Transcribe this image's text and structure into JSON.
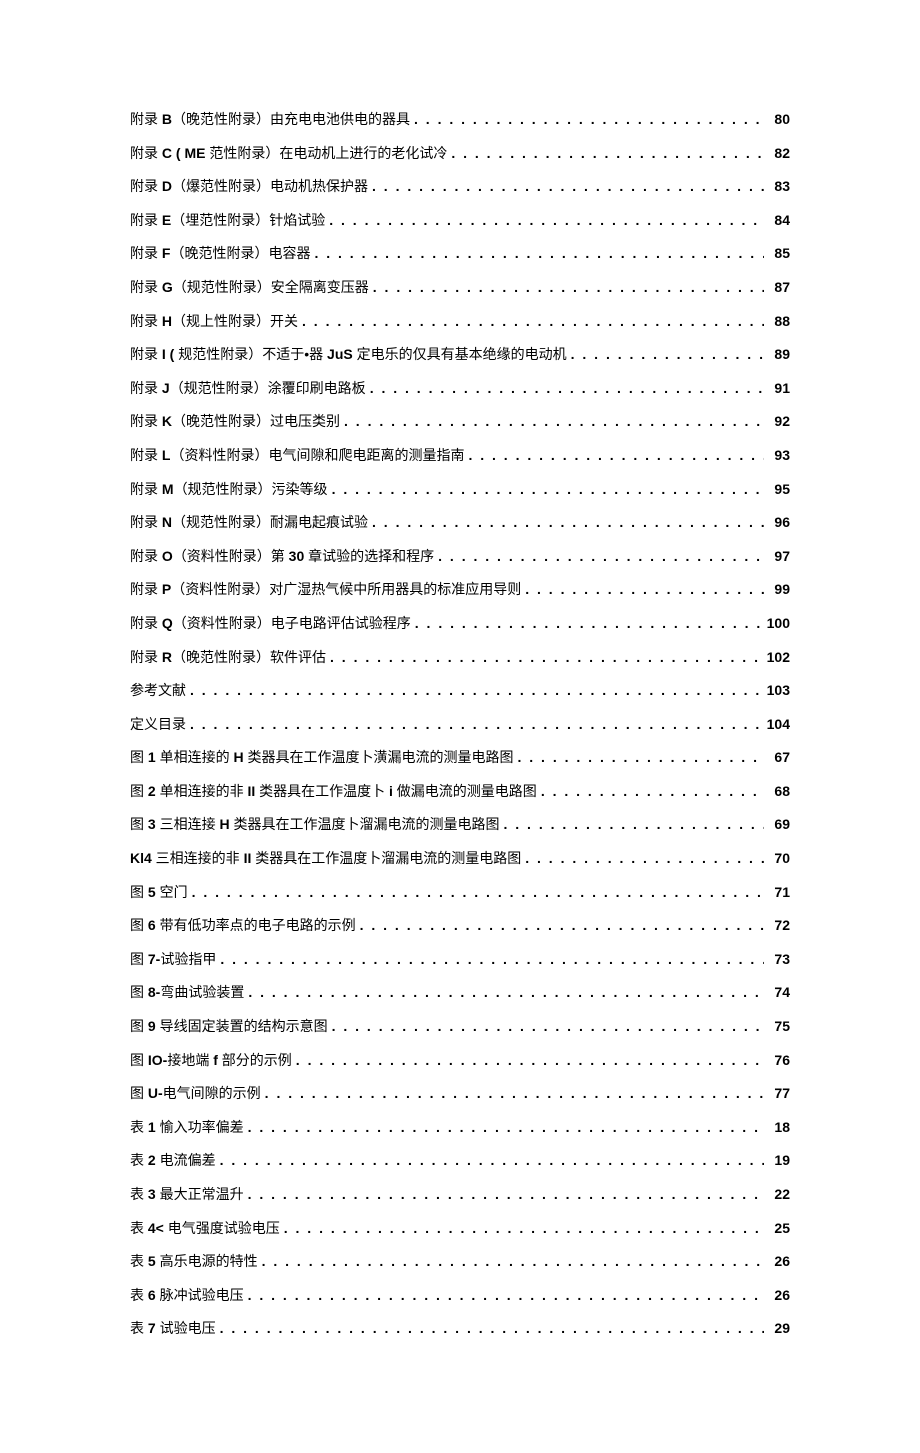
{
  "entries": [
    {
      "label": "附录 <b>B</b>（晚范性附录）由充电电池供电的器具",
      "page": "80"
    },
    {
      "label": "附录 <b>C ( ME</b> 范性附录）在电动机上进行的老化试冷",
      "page": "82"
    },
    {
      "label": "附录 <b>D</b>（爆范性附录）电动机热保护器",
      "page": "83"
    },
    {
      "label": "附录 <b>E</b>（埋范性附录）针焰试验",
      "page": "84"
    },
    {
      "label": "附录 <b>F</b>（晚范性附录）电容器",
      "page": "85"
    },
    {
      "label": "附录 <b>G</b>（规范性附录）安全隔离变压器",
      "page": "87"
    },
    {
      "label": "附录 <b>H</b>（规上性附录）开关",
      "page": "88"
    },
    {
      "label": "附录 <b>I (</b> 规范性附录）不适于•器 <b>JuS</b> 定电乐的仅具有基本绝缘的电动机",
      "page": "89"
    },
    {
      "label": "附录 <b>J</b>（规范性附录）涂覆印刷电路板",
      "page": "91"
    },
    {
      "label": "附录 <b>K</b>（晚范性附录）过电压类别",
      "page": "92"
    },
    {
      "label": "附录 <b>L</b>（资料性附录）电气间隙和爬电距离的测量指南",
      "page": "93"
    },
    {
      "label": "附录 <b>M</b>（规范性附录）污染等级",
      "page": "95"
    },
    {
      "label": "附录 <b>N</b>（规范性附录）耐漏电起痕试验",
      "page": "96"
    },
    {
      "label": "附录 <b>O</b>（资料性附录）第 <b>30</b> 章试验的选择和程序",
      "page": "97"
    },
    {
      "label": "附录 <b>P</b>（资料性附录）对广湿热气候中所用器具的标准应用导则",
      "page": "99"
    },
    {
      "label": "附录 <b>Q</b>（资料性附录）电子电路评估试验程序",
      "page": "100"
    },
    {
      "label": "附录 <b>R</b>（晚范性附录）软件评估",
      "page": "102"
    },
    {
      "label": "参考文献",
      "page": "103"
    },
    {
      "label": "定义目录",
      "page": "104"
    },
    {
      "label": "图 <b>1</b> 单相连接的 <b>H</b> 类器具在工作温度卜潢漏电流的测量电路图",
      "page": "67"
    },
    {
      "label": "图 <b>2</b> 单相连接的非 <b>II</b> 类器具在工作温度卜 <b>i</b> 做漏电流的测量电路图",
      "page": "68"
    },
    {
      "label": "图 <b>3</b> 三相连接 <b>H</b> 类器具在工作温度卜溜漏电流的测量电路图",
      "page": "69"
    },
    {
      "label": "<b>Kl4</b> 三相连接的非 <b>II</b> 类器具在工作温度卜溜漏电流的测量电路图",
      "page": "70"
    },
    {
      "label": "图 <b>5</b> 空门",
      "page": "71"
    },
    {
      "label": "图 <b>6</b> 带有低功率点的电子电路的示例",
      "page": "72"
    },
    {
      "label": "图 <b>7-</b>试验指甲",
      "page": "73"
    },
    {
      "label": "图 <b>8-</b>弯曲试验装置",
      "page": "74"
    },
    {
      "label": "图 <b>9</b> 导线固定装置的结构示意图",
      "page": "75"
    },
    {
      "label": "图 <b>IO-</b>接地端 <b>f</b> 部分的示例",
      "page": "76"
    },
    {
      "label": "图 <b>U-</b>电气间隙的示例",
      "page": "77"
    },
    {
      "label": "表 <b>1</b> 愉入功率偏差",
      "page": "18"
    },
    {
      "label": "表 <b>2</b> 电流偏差",
      "page": "19"
    },
    {
      "label": "表 <b>3</b> 最大正常温升",
      "page": "22"
    },
    {
      "label": "表 <b>4&lt;</b> 电气强度试验电压",
      "page": "25"
    },
    {
      "label": "表 <b>5</b> 高乐电源的特性",
      "page": "26"
    },
    {
      "label": "表 <b>6</b> 脉冲试验电压",
      "page": "26"
    },
    {
      "label": "表 <b>7</b> 试验电压",
      "page": "29"
    }
  ]
}
